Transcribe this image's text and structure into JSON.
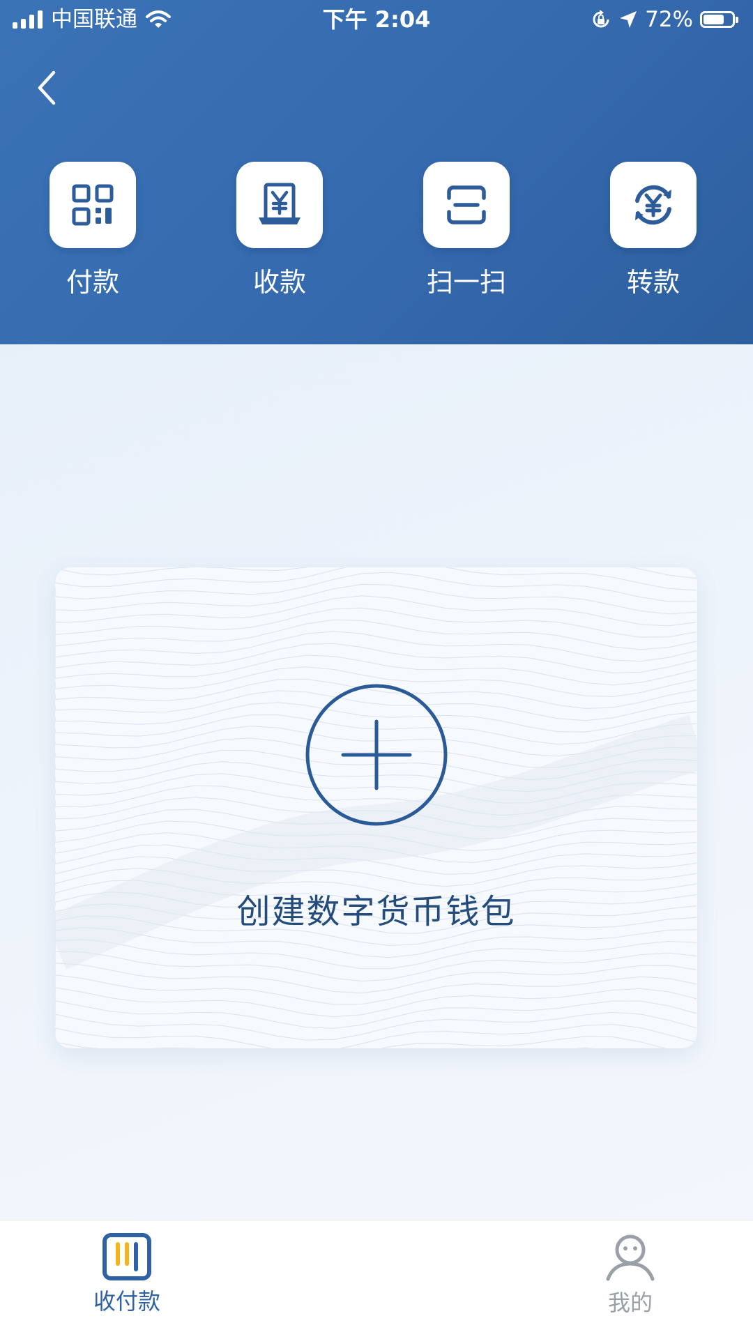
{
  "status_bar": {
    "carrier": "中国联通",
    "time": "下午 2:04",
    "battery_text": "72%",
    "battery_level": 0.72,
    "icons": [
      "signal-icon",
      "wifi-icon",
      "orientation-lock-icon",
      "location-arrow-icon",
      "battery-icon"
    ]
  },
  "nav": {
    "back_icon": "chevron-left-icon"
  },
  "actions": [
    {
      "label": "付款",
      "icon": "qr-code-icon"
    },
    {
      "label": "收款",
      "icon": "yuan-receipt-icon"
    },
    {
      "label": "扫一扫",
      "icon": "scan-icon"
    },
    {
      "label": "转款",
      "icon": "yuan-transfer-icon"
    }
  ],
  "card": {
    "label": "创建数字货币钱包",
    "icon": "plus-circle-icon"
  },
  "tabs": [
    {
      "label": "收付款",
      "icon": "payments-tab-icon",
      "active": true
    },
    {
      "label": "我的",
      "icon": "person-icon",
      "active": false
    }
  ],
  "colors": {
    "header_blue": "#3a73b6",
    "accent_blue": "#2f62a5",
    "icon_blue": "#2c5c9a",
    "tab_yellow": "#f2b51c",
    "inactive_gray": "#9aa0a8"
  }
}
